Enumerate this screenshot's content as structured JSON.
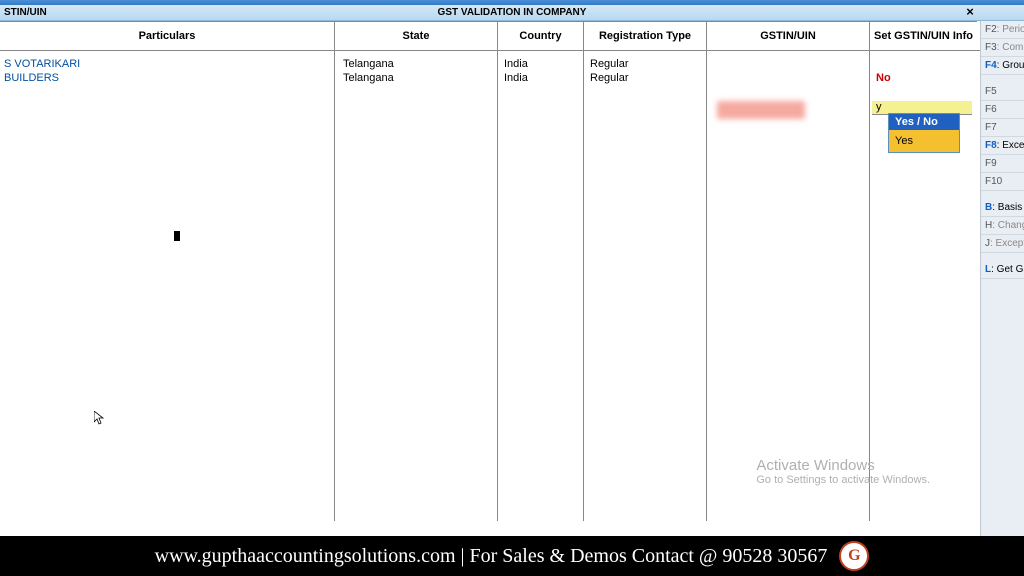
{
  "titlebar": {
    "left": "STIN/UIN",
    "center": "GST VALIDATION IN COMPANY",
    "close": "×"
  },
  "columns": {
    "particulars": "Particulars",
    "state": "State",
    "country": "Country",
    "regtype": "Registration Type",
    "gstin": "GSTIN/UIN",
    "setinfo": "Set GSTIN/UIN Info"
  },
  "rows": [
    {
      "particulars": "S VOTARIKARI",
      "state": "Telangana",
      "country": "India",
      "regtype": "Regular",
      "gstin": "",
      "setinfo": "y"
    },
    {
      "particulars": " BUILDERS",
      "state": "Telangana",
      "country": "India",
      "regtype": "Regular",
      "gstin": "",
      "setinfo": "No"
    }
  ],
  "dropdown": {
    "title": "Yes / No",
    "options": [
      "Yes"
    ]
  },
  "input_value": "y",
  "sidebar": [
    {
      "key": "F2",
      "label": ": Perio",
      "active": false
    },
    {
      "key": "F3",
      "label": ": Comp",
      "active": false
    },
    {
      "key": "F4",
      "label": ": Group",
      "active": true
    },
    {
      "gap": true
    },
    {
      "key": "F5",
      "label": "",
      "active": false
    },
    {
      "key": "F6",
      "label": "",
      "active": false
    },
    {
      "key": "F7",
      "label": "",
      "active": false
    },
    {
      "key": "F8",
      "label": ": Excep",
      "active": true
    },
    {
      "key": "F9",
      "label": "",
      "active": false
    },
    {
      "key": "F10",
      "label": "",
      "active": false
    },
    {
      "gap": true
    },
    {
      "key": "B",
      "label": ": Basis o",
      "active": true
    },
    {
      "key": "H",
      "label": ": Chang",
      "active": false
    },
    {
      "key": "J",
      "label": ": Excepti",
      "active": false
    },
    {
      "gap": true
    },
    {
      "key": "L",
      "label": ": Get GS",
      "active": true
    }
  ],
  "watermark": {
    "title": "Activate Windows",
    "sub": "Go to Settings to activate Windows."
  },
  "footer": {
    "text": "www.gupthaaccountingsolutions.com | For Sales & Demos Contact @ 90528 30567",
    "logo": "G"
  }
}
